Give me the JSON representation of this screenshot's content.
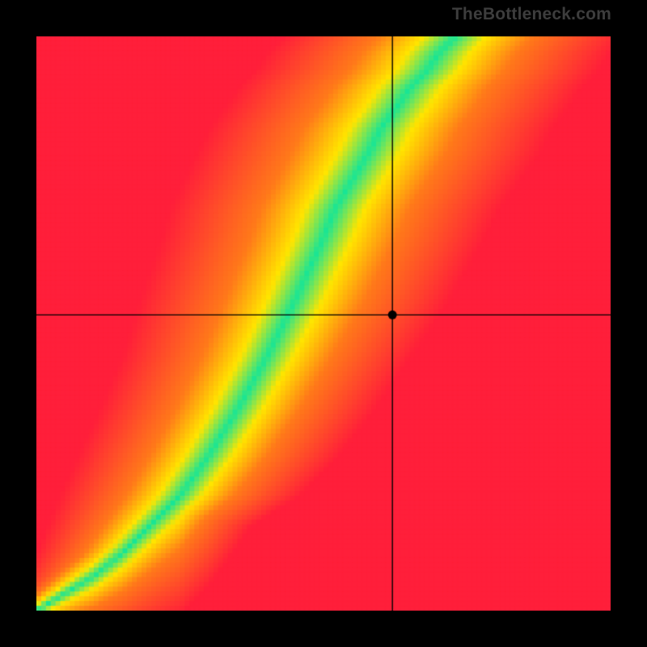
{
  "watermark": "TheBottleneck.com",
  "chart_data": {
    "type": "heatmap",
    "title": "",
    "xlabel": "",
    "ylabel": "",
    "xlim": [
      0,
      1
    ],
    "ylim": [
      0,
      1
    ],
    "crosshair": {
      "x": 0.62,
      "y": 0.515
    },
    "marker": {
      "x": 0.62,
      "y": 0.515
    },
    "optimal_curve_x": [
      0.0,
      0.05,
      0.1,
      0.15,
      0.2,
      0.25,
      0.3,
      0.35,
      0.4,
      0.45,
      0.5,
      0.52,
      0.55,
      0.58,
      0.6,
      0.63,
      0.65,
      0.68,
      0.7,
      0.73
    ],
    "optimal_curve_y": [
      0.0,
      0.03,
      0.06,
      0.1,
      0.15,
      0.2,
      0.27,
      0.35,
      0.44,
      0.54,
      0.65,
      0.7,
      0.75,
      0.8,
      0.84,
      0.88,
      0.91,
      0.94,
      0.97,
      1.0
    ],
    "band_half_width": [
      0.01,
      0.015,
      0.02,
      0.025,
      0.03,
      0.035,
      0.038,
      0.04,
      0.042,
      0.045,
      0.047,
      0.048,
      0.049,
      0.05,
      0.05,
      0.05,
      0.05,
      0.05,
      0.05,
      0.05
    ],
    "colors": {
      "red": "#ff1f3a",
      "orange": "#ff7a1a",
      "yellow": "#ffe600",
      "green": "#18e596"
    },
    "pixel_resolution": 120
  }
}
